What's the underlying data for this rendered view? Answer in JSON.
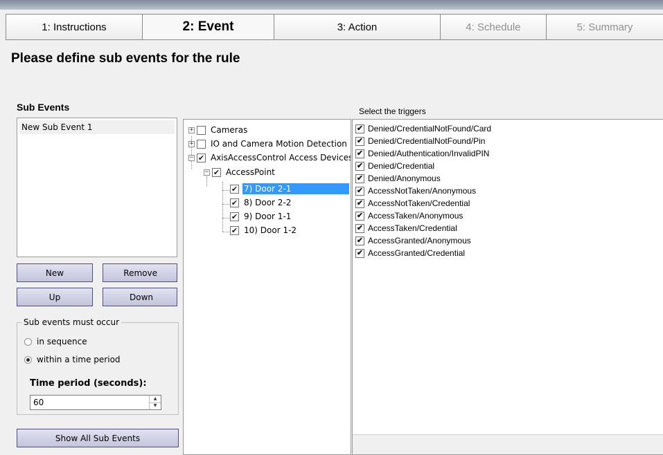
{
  "tabs": [
    {
      "label": "1: Instructions",
      "state": "normal"
    },
    {
      "label": "2: Event",
      "state": "active"
    },
    {
      "label": "3: Action",
      "state": "normal"
    },
    {
      "label": "4: Schedule",
      "state": "disabled"
    },
    {
      "label": "5: Summary",
      "state": "disabled"
    }
  ],
  "heading": "Please define sub events for the rule",
  "sub_events": {
    "title": "Sub Events",
    "items": [
      "New Sub Event 1"
    ],
    "buttons": {
      "new": "New",
      "remove": "Remove",
      "up": "Up",
      "down": "Down",
      "show_all": "Show All Sub Events"
    }
  },
  "occurrence": {
    "legend": "Sub events must occur",
    "options": [
      {
        "label": "in sequence",
        "selected": false
      },
      {
        "label": "within a time period",
        "selected": true
      }
    ],
    "time_label": "Time period (seconds):",
    "time_value": "60"
  },
  "tree": {
    "cameras": {
      "label": "Cameras",
      "checked": false
    },
    "io_motion": {
      "label": "IO and Camera Motion Detection",
      "checked": false
    },
    "access_devices": {
      "label": "AxisAccessControl Access Devices",
      "checked": true
    },
    "access_point": {
      "label": "AccessPoint",
      "checked": true
    },
    "doors": [
      {
        "label": "7) Door 2-1",
        "checked": true,
        "selected": true
      },
      {
        "label": "8) Door 2-2",
        "checked": true,
        "selected": false
      },
      {
        "label": "9) Door 1-1",
        "checked": true,
        "selected": false
      },
      {
        "label": "10) Door 1-2",
        "checked": true,
        "selected": false
      }
    ]
  },
  "triggers": {
    "title": "Select the triggers",
    "items": [
      {
        "label": "Denied/CredentialNotFound/Card",
        "checked": true
      },
      {
        "label": "Denied/CredentialNotFound/Pin",
        "checked": true
      },
      {
        "label": "Denied/Authentication/InvalidPIN",
        "checked": true
      },
      {
        "label": "Denied/Credential",
        "checked": true
      },
      {
        "label": "Denied/Anonymous",
        "checked": true
      },
      {
        "label": "AccessNotTaken/Anonymous",
        "checked": true
      },
      {
        "label": "AccessNotTaken/Credential",
        "checked": true
      },
      {
        "label": "AccessTaken/Anonymous",
        "checked": true
      },
      {
        "label": "AccessTaken/Credential",
        "checked": true
      },
      {
        "label": "AccessGranted/Anonymous",
        "checked": true
      },
      {
        "label": "AccessGranted/Credential",
        "checked": true
      }
    ]
  },
  "icons": {
    "check": "✔",
    "expand": "+",
    "collapse": "−"
  }
}
